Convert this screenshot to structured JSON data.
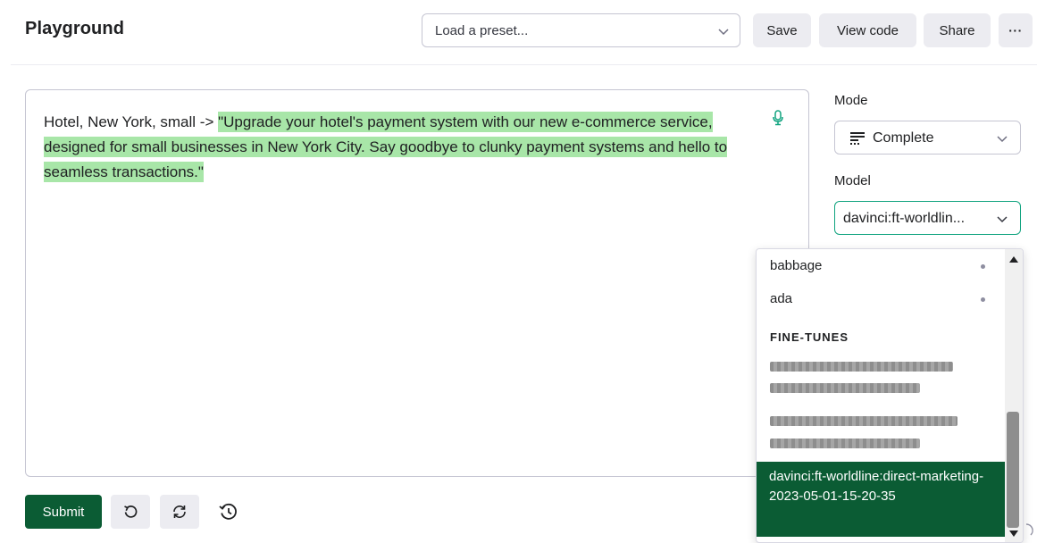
{
  "header": {
    "title": "Playground",
    "preset_placeholder": "Load a preset...",
    "save_label": "Save",
    "view_code_label": "View code",
    "share_label": "Share",
    "more_label": "···"
  },
  "editor": {
    "prompt_text": "Hotel, New York, small -> ",
    "completion_text": "\"Upgrade your hotel's payment system with our new e-commerce service, designed for small businesses in New York City. Say goodbye to clunky payment systems and hello to seamless transactions.\""
  },
  "sidebar": {
    "mode_label": "Mode",
    "mode_value": "Complete",
    "model_label": "Model",
    "model_value": "davinci:ft-worldlin..."
  },
  "model_dropdown": {
    "options": [
      {
        "label": "babbage"
      },
      {
        "label": "ada"
      }
    ],
    "section_label": "FINE-TUNES",
    "selected_label": "davinci:ft-worldline:direct-marketing-2023-05-01-15-20-35"
  },
  "footer": {
    "submit_label": "Submit"
  },
  "colors": {
    "accent": "#0b5c34",
    "highlight": "#a8e6a8",
    "focus_border": "#10a37f"
  },
  "icons": [
    "chevron-down-icon",
    "microphone-icon",
    "complete-mode-icon",
    "scroll-up-icon",
    "scroll-down-icon",
    "undo-icon",
    "regenerate-icon",
    "history-icon"
  ]
}
